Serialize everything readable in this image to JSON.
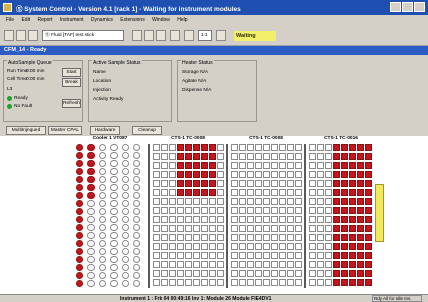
{
  "window": {
    "title": "Ⓢ System Control - Version 4.1 [rack 1] - Waiting for instrument modules"
  },
  "menu": [
    "File",
    "Edit",
    "Report",
    "Instrument",
    "Dynamics",
    "Extensions",
    "Window",
    "Help"
  ],
  "toolbar": {
    "instrument_select": "Ⓢ Fluid [TAF] test stick",
    "status": "Waiting",
    "zoom_select": "1:1"
  },
  "inner_window": {
    "title": "CFM_14 - Ready"
  },
  "auto_sample": {
    "title": "AutoSample Queue",
    "run_time_label": "Run Time",
    "run_time_value": "0:00 min",
    "cell_time_label": "Cell Time",
    "cell_time_value": "0:00 min",
    "start_button": "Start",
    "break_button": "Break",
    "rack_label": "L3",
    "indicator1": "Ready",
    "indicator2": "No Fault",
    "refresh_button": "Refresh"
  },
  "active_sample": {
    "title": "Active Sample Status",
    "rows": [
      "Name",
      "Location",
      "Injection",
      "Activity    Ready"
    ]
  },
  "heater": {
    "title": "Heater Status",
    "rows": [
      "Storage   N/A",
      "Agitate   N/A",
      "Dispense   N/A"
    ]
  },
  "tabs": [
    "MultiInjnqued",
    "Master CPAL",
    "Hardware",
    "Cleanup"
  ],
  "zones": {
    "z1": "Cooler 1 VT087",
    "z2": "CTS-1 TC-0008",
    "z3": "CTS-1 TC-0008",
    "z4": "CTS-1 TC-0016"
  },
  "rack_state": {
    "z1_filled": [
      [
        1,
        1,
        1,
        1,
        1,
        1,
        1,
        1,
        1,
        1,
        1,
        1,
        1,
        1,
        1,
        1,
        1,
        1
      ],
      [
        1,
        1,
        1,
        1,
        1,
        1,
        1,
        0,
        0,
        0,
        0,
        0,
        0,
        0,
        0,
        0,
        0,
        0
      ]
    ],
    "z2_filled_rows": 6,
    "z4_filled_rows": 12
  },
  "statusbar": {
    "text": "Instrument 1 : Frk 04 00:49:16  Inv 1: Module 26 Module FIE4DV1",
    "right": "Rdy   All for Idle Ins."
  }
}
